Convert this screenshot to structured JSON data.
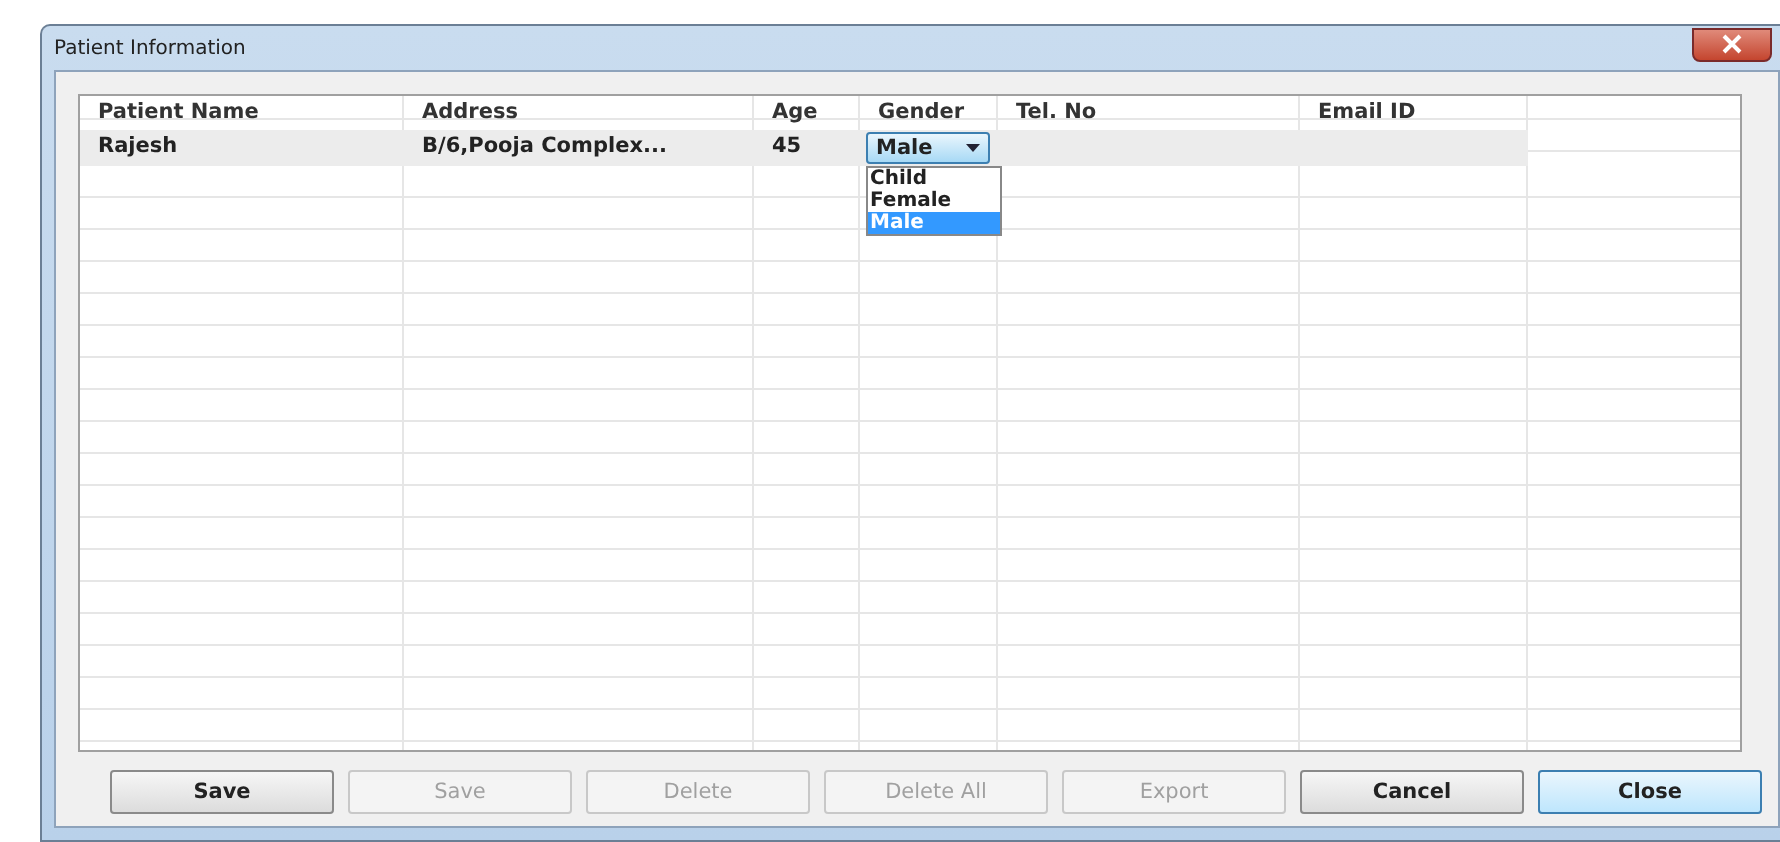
{
  "window": {
    "title": "Patient Information"
  },
  "table": {
    "columns": [
      "Patient Name",
      "Address",
      "Age",
      "Gender",
      "Tel. No",
      "Email ID"
    ],
    "rows": [
      {
        "patient_name": "Rajesh",
        "address": "B/6,Pooja Complex...",
        "age": "45",
        "gender": {
          "value": "Male",
          "expanded": true,
          "options": [
            {
              "label": "Child",
              "selected": false
            },
            {
              "label": "Female",
              "selected": false
            },
            {
              "label": "Male",
              "selected": true
            }
          ]
        }
      }
    ]
  },
  "buttons": [
    {
      "label": "Save",
      "disabled": false
    },
    {
      "label": "Save",
      "disabled": true
    },
    {
      "label": "Delete",
      "disabled": true
    },
    {
      "label": "Delete All",
      "disabled": true
    },
    {
      "label": "Export",
      "disabled": true
    },
    {
      "label": "Cancel",
      "disabled": false
    },
    {
      "label": "Close",
      "disabled": false,
      "selected": true
    }
  ]
}
